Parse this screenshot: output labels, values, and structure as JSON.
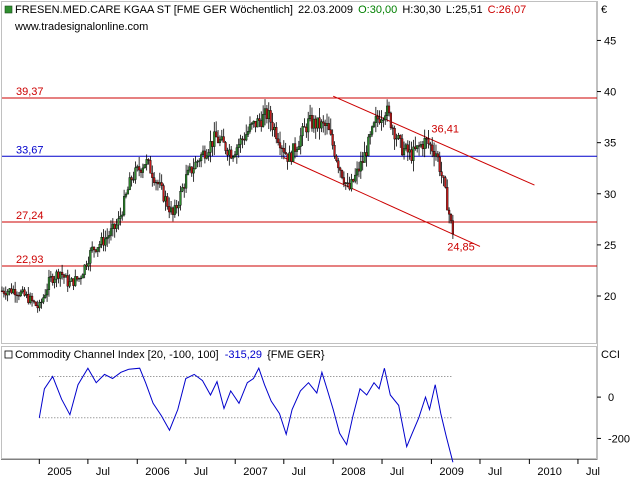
{
  "header": {
    "instrument": "FRESEN.MED.CARE KGAA ST [FME GER  Wöchentlich]",
    "date": "22.03.2009",
    "open": "O:30,00",
    "high": "H:30,30",
    "low": "L:25,51",
    "close": "C:26,07",
    "website": "www.tradesignalonline.com",
    "currency": "€",
    "close_color": "#cc0000",
    "open_color": "#008000"
  },
  "indicator": {
    "label": "Commodity Channel Index [20, -100, 100]",
    "value": "-315,29",
    "symbol": "{FME GER}",
    "axis_label": "CCI",
    "value_color": "#0000cc"
  },
  "chart_data": [
    {
      "type": "candlestick",
      "title": "FRESEN.MED.CARE KGAA ST [FME GER  Wöchentlich]",
      "y_axis_side": "right",
      "ylim": [
        15.5,
        47
      ],
      "yticks": [
        20,
        25,
        30,
        35,
        40,
        45
      ],
      "ytick_labels": [
        "20",
        "25",
        "30",
        "35",
        "40",
        "45"
      ],
      "x_axis": {
        "range": [
          "2004-08-15",
          "2010-09-10"
        ],
        "ticks": [
          {
            "date": "2005-01-01",
            "label": "2005"
          },
          {
            "date": "2005-07-01",
            "label": "Jul"
          },
          {
            "date": "2006-01-01",
            "label": "2006"
          },
          {
            "date": "2006-07-01",
            "label": "Jul"
          },
          {
            "date": "2007-01-01",
            "label": "2007"
          },
          {
            "date": "2007-07-01",
            "label": "Jul"
          },
          {
            "date": "2008-01-01",
            "label": "2008"
          },
          {
            "date": "2008-07-01",
            "label": "Jul"
          },
          {
            "date": "2009-01-01",
            "label": "2009"
          },
          {
            "date": "2009-07-01",
            "label": "Jul"
          },
          {
            "date": "2010-01-01",
            "label": "2010"
          },
          {
            "date": "2010-07-01",
            "label": "Jul"
          }
        ]
      },
      "price_path": [
        [
          "2004-08-15",
          20.5
        ],
        [
          "2004-10-01",
          20.6
        ],
        [
          "2004-11-20",
          19.8
        ],
        [
          "2004-12-31",
          18.8
        ],
        [
          "2005-02-10",
          21.6
        ],
        [
          "2005-03-20",
          22.4
        ],
        [
          "2005-04-20",
          21.2
        ],
        [
          "2005-06-01",
          21.8
        ],
        [
          "2005-07-15",
          24.5
        ],
        [
          "2005-09-01",
          25.5
        ],
        [
          "2005-10-20",
          27.0
        ],
        [
          "2005-12-10",
          31.5
        ],
        [
          "2006-02-01",
          33.2
        ],
        [
          "2006-02-28",
          32.0
        ],
        [
          "2006-04-15",
          29.5
        ],
        [
          "2006-05-15",
          27.8
        ],
        [
          "2006-07-01",
          31.5
        ],
        [
          "2006-08-20",
          33.5
        ],
        [
          "2006-10-20",
          35.5
        ],
        [
          "2006-12-20",
          34.0
        ],
        [
          "2007-03-01",
          36.5
        ],
        [
          "2007-05-01",
          37.8
        ],
        [
          "2007-07-20",
          33.4
        ],
        [
          "2007-10-01",
          37.0
        ],
        [
          "2007-12-10",
          36.5
        ],
        [
          "2008-01-20",
          33.0
        ],
        [
          "2008-02-28",
          30.3
        ],
        [
          "2008-04-20",
          33.2
        ],
        [
          "2008-06-10",
          37.2
        ],
        [
          "2008-07-15",
          38.3
        ],
        [
          "2008-09-10",
          34.5
        ],
        [
          "2008-10-20",
          33.8
        ],
        [
          "2008-12-10",
          35.2
        ],
        [
          "2009-01-20",
          34.0
        ],
        [
          "2009-02-15",
          31.0
        ],
        [
          "2009-03-22",
          26.07
        ]
      ],
      "horizontal_lines": [
        {
          "value": 39.37,
          "label": "39,37",
          "color": "#cc0000"
        },
        {
          "value": 33.67,
          "label": "33,67",
          "color": "#0000cc"
        },
        {
          "value": 27.24,
          "label": "27,24",
          "color": "#cc0000"
        },
        {
          "value": 22.93,
          "label": "22,93",
          "color": "#cc0000"
        }
      ],
      "trend_lines": [
        {
          "from": [
            "2008-01-01",
            39.55
          ],
          "to": [
            "2010-01-20",
            30.85
          ],
          "color": "#cc0000"
        },
        {
          "from": [
            "2007-07-01",
            33.55
          ],
          "to": [
            "2009-07-01",
            24.85
          ],
          "color": "#cc0000"
        }
      ],
      "annotations": [
        {
          "text": "36,41",
          "date": "2009-01-01",
          "value": 36.41,
          "color": "#cc0000"
        },
        {
          "text": "24,85",
          "date": "2009-03-01",
          "value": 24.85,
          "color": "#cc0000"
        }
      ]
    },
    {
      "type": "line",
      "title": "Commodity Channel Index [20, -100, 100]",
      "ylim": [
        -290,
        170
      ],
      "yticks": [
        0,
        -200
      ],
      "ytick_labels": [
        "0",
        "-200"
      ],
      "reference_levels": [
        100,
        -100
      ],
      "series": [
        {
          "name": "{FME GER}",
          "color": "#0000cc",
          "points": [
            [
              "2005-01-01",
              -100
            ],
            [
              "2005-01-20",
              40
            ],
            [
              "2005-02-20",
              100
            ],
            [
              "2005-03-25",
              -10
            ],
            [
              "2005-04-25",
              -85
            ],
            [
              "2005-05-25",
              60
            ],
            [
              "2005-07-01",
              140
            ],
            [
              "2005-08-01",
              70
            ],
            [
              "2005-09-01",
              110
            ],
            [
              "2005-10-01",
              90
            ],
            [
              "2005-11-01",
              120
            ],
            [
              "2005-12-01",
              135
            ],
            [
              "2006-01-10",
              140
            ],
            [
              "2006-02-01",
              70
            ],
            [
              "2006-03-01",
              -30
            ],
            [
              "2006-04-01",
              -90
            ],
            [
              "2006-05-01",
              -160
            ],
            [
              "2006-06-01",
              -60
            ],
            [
              "2006-07-01",
              90
            ],
            [
              "2006-08-01",
              110
            ],
            [
              "2006-09-01",
              80
            ],
            [
              "2006-10-01",
              10
            ],
            [
              "2006-10-25",
              75
            ],
            [
              "2006-11-20",
              -55
            ],
            [
              "2006-12-15",
              30
            ],
            [
              "2007-01-15",
              -30
            ],
            [
              "2007-02-15",
              70
            ],
            [
              "2007-03-10",
              90
            ],
            [
              "2007-03-30",
              140
            ],
            [
              "2007-04-20",
              60
            ],
            [
              "2007-05-15",
              -20
            ],
            [
              "2007-06-15",
              -80
            ],
            [
              "2007-07-10",
              -180
            ],
            [
              "2007-08-01",
              -60
            ],
            [
              "2007-09-01",
              30
            ],
            [
              "2007-10-01",
              70
            ],
            [
              "2007-11-01",
              20
            ],
            [
              "2007-11-20",
              120
            ],
            [
              "2007-12-10",
              35
            ],
            [
              "2008-01-01",
              -60
            ],
            [
              "2008-01-25",
              -175
            ],
            [
              "2008-02-20",
              -230
            ],
            [
              "2008-03-15",
              -90
            ],
            [
              "2008-04-10",
              40
            ],
            [
              "2008-05-05",
              10
            ],
            [
              "2008-06-01",
              70
            ],
            [
              "2008-06-20",
              40
            ],
            [
              "2008-07-10",
              140
            ],
            [
              "2008-08-01",
              10
            ],
            [
              "2008-09-01",
              -40
            ],
            [
              "2008-10-01",
              -240
            ],
            [
              "2008-10-20",
              -180
            ],
            [
              "2008-11-15",
              -100
            ],
            [
              "2008-12-10",
              0
            ],
            [
              "2008-12-25",
              -60
            ],
            [
              "2009-01-15",
              60
            ],
            [
              "2009-02-05",
              -80
            ],
            [
              "2009-02-25",
              -190
            ],
            [
              "2009-03-22",
              -315.29
            ]
          ]
        }
      ]
    }
  ]
}
